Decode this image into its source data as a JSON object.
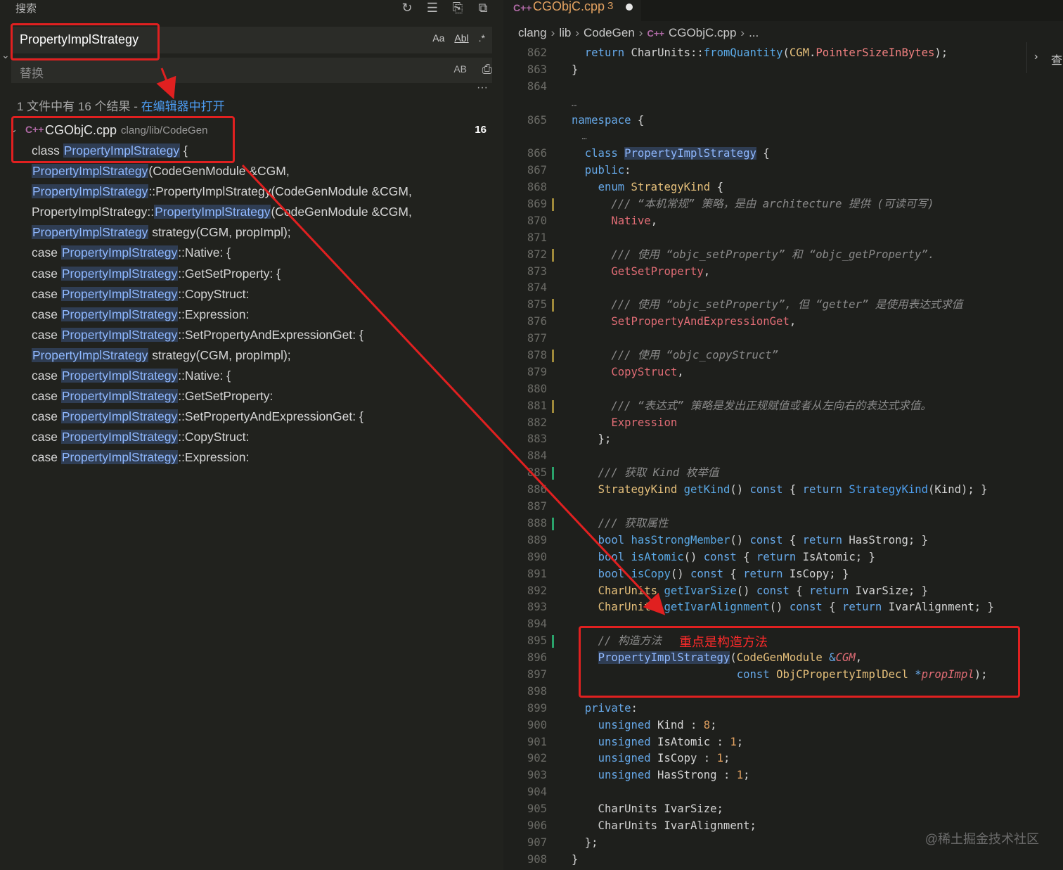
{
  "search_panel": {
    "title": "搜索",
    "query": "PropertyImplStrategy",
    "options": {
      "match_case": "Aa",
      "whole_word": "Abl",
      "regex": ".*"
    },
    "replace_placeholder": "替换",
    "preserve_case": "AB",
    "result_summary": "1 文件中有 16 个结果 - ",
    "open_in_editor": "在编辑器中打开",
    "file": {
      "name": "CGObjC.cpp",
      "path": "clang/lib/CodeGen",
      "count": "16"
    },
    "matches": [
      {
        "pre": "class ",
        "hl": "PropertyImplStrategy",
        "post": " {"
      },
      {
        "pre": "",
        "hl": "PropertyImplStrategy",
        "post": "(CodeGenModule &CGM,"
      },
      {
        "pre": "",
        "hl": "PropertyImplStrategy",
        "post": "::PropertyImplStrategy(CodeGenModule &CGM,"
      },
      {
        "pre": "PropertyImplStrategy::",
        "hl": "PropertyImplStrategy",
        "post": "(CodeGenModule &CGM,"
      },
      {
        "pre": "",
        "hl": "PropertyImplStrategy",
        "post": " strategy(CGM, propImpl);"
      },
      {
        "pre": "case ",
        "hl": "PropertyImplStrategy",
        "post": "::Native: {"
      },
      {
        "pre": "case ",
        "hl": "PropertyImplStrategy",
        "post": "::GetSetProperty: {"
      },
      {
        "pre": "case ",
        "hl": "PropertyImplStrategy",
        "post": "::CopyStruct:"
      },
      {
        "pre": "case ",
        "hl": "PropertyImplStrategy",
        "post": "::Expression:"
      },
      {
        "pre": "case ",
        "hl": "PropertyImplStrategy",
        "post": "::SetPropertyAndExpressionGet: {"
      },
      {
        "pre": "",
        "hl": "PropertyImplStrategy",
        "post": " strategy(CGM, propImpl);"
      },
      {
        "pre": "case ",
        "hl": "PropertyImplStrategy",
        "post": "::Native: {"
      },
      {
        "pre": "case ",
        "hl": "PropertyImplStrategy",
        "post": "::GetSetProperty:"
      },
      {
        "pre": "case ",
        "hl": "PropertyImplStrategy",
        "post": "::SetPropertyAndExpressionGet: {"
      },
      {
        "pre": "case ",
        "hl": "PropertyImplStrategy",
        "post": "::CopyStruct:"
      },
      {
        "pre": "case ",
        "hl": "PropertyImplStrategy",
        "post": "::Expression:"
      }
    ]
  },
  "editor": {
    "tab": {
      "name": "CGObjC.cpp",
      "problems": "3"
    },
    "breadcrumb": [
      "clang",
      "lib",
      "CodeGen",
      "CGObjC.cpp",
      "..."
    ],
    "outline_label": "查",
    "lines": [
      {
        "n": "862",
        "html": "  <span class='kw'>return</span> CharUnits::<span class='fn'>fromQuantity</span>(<span class='typ'>CGM</span>.<span class='pr'>PointerSizeInBytes</span>);"
      },
      {
        "n": "863",
        "html": "}"
      },
      {
        "n": "864",
        "html": ""
      },
      {
        "n": "",
        "html": "",
        "fold": "…"
      },
      {
        "n": "865",
        "html": "<span class='kw'>namespace</span> {"
      },
      {
        "n": "",
        "html": "",
        "fold": "  …"
      },
      {
        "n": "866",
        "html": "  <span class='kw'>class</span> <span class='typ hlw'>PropertyImplStrategy</span> {"
      },
      {
        "n": "867",
        "html": "  <span class='kw'>public</span>:"
      },
      {
        "n": "868",
        "html": "    <span class='kw'>enum</span> <span class='typ'>StrategyKind</span> {"
      },
      {
        "n": "869",
        "mark": "#a08a3a",
        "html": "      <span class='cm'>/// “本机常规” 策略，是由 architecture 提供 (可读可写)</span>"
      },
      {
        "n": "870",
        "html": "      <span class='en'>Native</span>,"
      },
      {
        "n": "871",
        "html": ""
      },
      {
        "n": "872",
        "mark": "#a08a3a",
        "html": "      <span class='cm'>/// 使用 “objc_setProperty” 和 “objc_getProperty”.</span>"
      },
      {
        "n": "873",
        "html": "      <span class='en'>GetSetProperty</span>,"
      },
      {
        "n": "874",
        "html": ""
      },
      {
        "n": "875",
        "mark": "#a08a3a",
        "html": "      <span class='cm'>/// 使用 “objc_setProperty”, 但 “getter” 是使用表达式求值</span>"
      },
      {
        "n": "876",
        "html": "      <span class='en'>SetPropertyAndExpressionGet</span>,"
      },
      {
        "n": "877",
        "html": ""
      },
      {
        "n": "878",
        "mark": "#a08a3a",
        "html": "      <span class='cm'>/// 使用 “objc_copyStruct”</span>"
      },
      {
        "n": "879",
        "html": "      <span class='en'>CopyStruct</span>,"
      },
      {
        "n": "880",
        "html": ""
      },
      {
        "n": "881",
        "mark": "#a08a3a",
        "html": "      <span class='cm'>/// “表达式” 策略是发出正规赋值或者从左向右的表达式求值。</span>"
      },
      {
        "n": "882",
        "html": "      <span class='en'>Expression</span>"
      },
      {
        "n": "883",
        "html": "    };"
      },
      {
        "n": "884",
        "html": ""
      },
      {
        "n": "885",
        "mark": "#2aa36b",
        "html": "    <span class='cm'>/// 获取 Kind 枚举值</span>"
      },
      {
        "n": "886",
        "html": "    <span class='typ'>StrategyKind</span> <span class='fn'>getKind</span>() <span class='kw'>const</span> { <span class='kw'>return</span> <span class='fn2'>StrategyKind</span>(Kind); }"
      },
      {
        "n": "887",
        "html": ""
      },
      {
        "n": "888",
        "mark": "#2aa36b",
        "html": "    <span class='cm'>/// 获取属性</span>"
      },
      {
        "n": "889",
        "html": "    <span class='kw'>bool</span> <span class='fn'>hasStrongMember</span>() <span class='kw'>const</span> { <span class='kw'>return</span> HasStrong; }"
      },
      {
        "n": "890",
        "html": "    <span class='kw'>bool</span> <span class='fn'>isAtomic</span>() <span class='kw'>const</span> { <span class='kw'>return</span> IsAtomic; }"
      },
      {
        "n": "891",
        "html": "    <span class='kw'>bool</span> <span class='fn'>isCopy</span>() <span class='kw'>const</span> { <span class='kw'>return</span> IsCopy; }"
      },
      {
        "n": "892",
        "html": "    <span class='typ'>CharUnits</span> <span class='fn'>getIvarSize</span>() <span class='kw'>const</span> { <span class='kw'>return</span> IvarSize; }"
      },
      {
        "n": "893",
        "html": "    <span class='typ'>CharUnits</span> <span class='fn'>getIvarAlignment</span>() <span class='kw'>const</span> { <span class='kw'>return</span> IvarAlignment; }"
      },
      {
        "n": "894",
        "html": ""
      },
      {
        "n": "895",
        "mark": "#2aa36b",
        "html": "    <span class='cm'>// 构造方法</span>"
      },
      {
        "n": "896",
        "html": "    <span class='fn2 hlw'>PropertyImplStrategy</span>(<span class='typ'>CodeGenModule</span> <span class='kw'>&amp;</span><span class='it'>CGM</span>,"
      },
      {
        "n": "897",
        "html": "                         <span class='kw'>const</span> <span class='typ'>ObjCPropertyImplDecl</span> <span class='kw'>*</span><span class='it'>propImpl</span>);"
      },
      {
        "n": "898",
        "html": ""
      },
      {
        "n": "899",
        "html": "  <span class='kw'>private</span>:"
      },
      {
        "n": "900",
        "html": "    <span class='kw'>unsigned</span> Kind : <span class='num'>8</span>;"
      },
      {
        "n": "901",
        "html": "    <span class='kw'>unsigned</span> IsAtomic : <span class='num'>1</span>;"
      },
      {
        "n": "902",
        "html": "    <span class='kw'>unsigned</span> IsCopy : <span class='num'>1</span>;"
      },
      {
        "n": "903",
        "html": "    <span class='kw'>unsigned</span> HasStrong : <span class='num'>1</span>;"
      },
      {
        "n": "904",
        "html": ""
      },
      {
        "n": "905",
        "html": "    CharUnits IvarSize;"
      },
      {
        "n": "906",
        "html": "    CharUnits IvarAlignment;"
      },
      {
        "n": "907",
        "html": "  };"
      },
      {
        "n": "908",
        "html": "}"
      }
    ]
  },
  "annotation": {
    "label": "重点是构造方法",
    "color": "#e02020"
  },
  "watermark": "@稀土掘金技术社区"
}
